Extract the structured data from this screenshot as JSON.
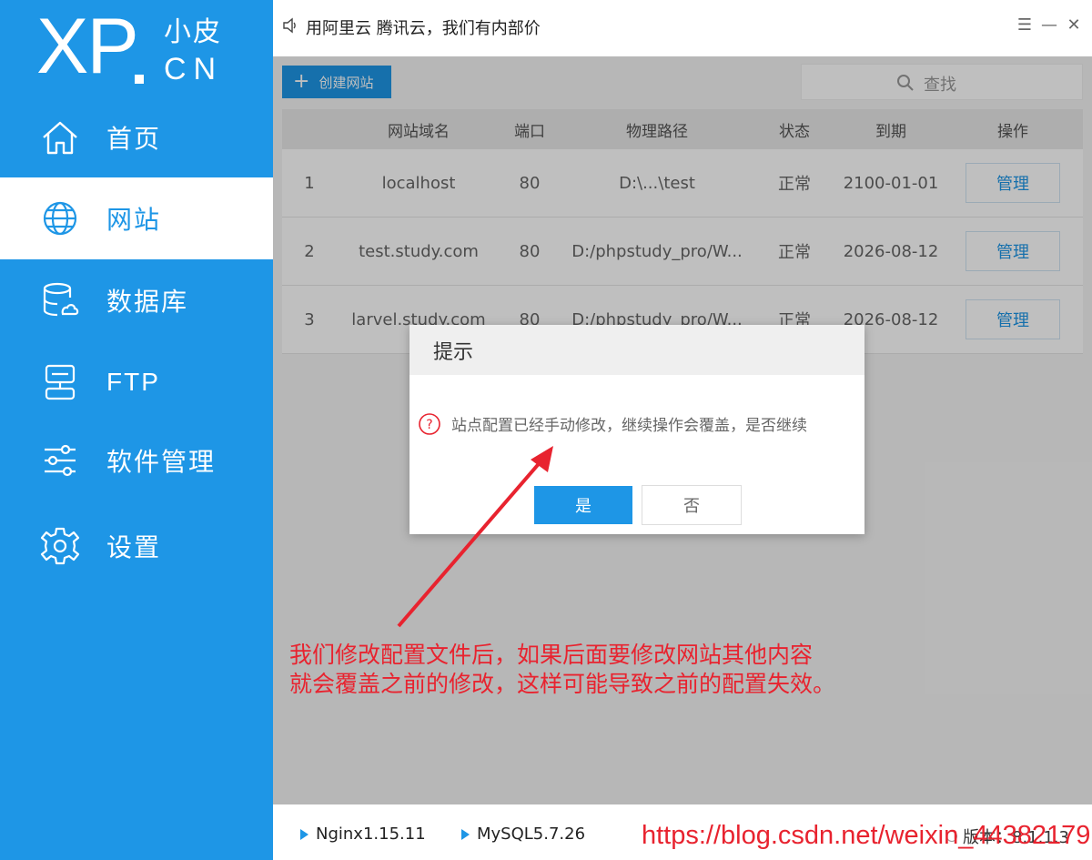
{
  "logo": {
    "xp": "XP",
    "zh": "小皮",
    "cn": "CN"
  },
  "sidebar": {
    "items": [
      {
        "label": "首页",
        "icon": "home-icon",
        "active": false
      },
      {
        "label": "网站",
        "icon": "globe-icon",
        "active": true
      },
      {
        "label": "数据库",
        "icon": "database-icon",
        "active": false
      },
      {
        "label": "FTP",
        "icon": "ftp-icon",
        "active": false
      },
      {
        "label": "软件管理",
        "icon": "sliders-icon",
        "active": false
      },
      {
        "label": "设置",
        "icon": "gear-icon",
        "active": false
      }
    ]
  },
  "titlebar": {
    "notice": "用阿里云 腾讯云，我们有内部价",
    "menu_glyph": "☰",
    "minimize_glyph": "—",
    "close_glyph": "✕"
  },
  "toolbar": {
    "create_label": "创建网站",
    "search_label": "查找"
  },
  "table": {
    "headers": [
      "网站域名",
      "端口",
      "物理路径",
      "状态",
      "到期",
      "操作"
    ],
    "rows": [
      {
        "index": "1",
        "domain": "localhost",
        "port": "80",
        "path": "D:\\...\\test",
        "status": "正常",
        "expiry": "2100-01-01",
        "action": "管理"
      },
      {
        "index": "2",
        "domain": "test.study.com",
        "port": "80",
        "path": "D:/phpstudy_pro/W...",
        "status": "正常",
        "expiry": "2026-08-12",
        "action": "管理"
      },
      {
        "index": "3",
        "domain": "larvel.study.com",
        "port": "80",
        "path": "D:/phpstudy_pro/W...",
        "status": "正常",
        "expiry": "2026-08-12",
        "action": "管理"
      }
    ]
  },
  "dialog": {
    "title": "提示",
    "message": "站点配置已经手动修改，继续操作会覆盖，是否继续",
    "yes_label": "是",
    "no_label": "否"
  },
  "annotation": {
    "line1": "我们修改配置文件后，如果后面要修改网站其他内容",
    "line2": "就会覆盖之前的修改，这样可能导致之前的配置失效。"
  },
  "statusbar": {
    "nginx": "Nginx1.15.11",
    "mysql": "MySQL5.7.26",
    "version": "版本：8.1.1.3"
  },
  "watermark": "https://blog.csdn.net/weixin_44382179",
  "colors": {
    "accent": "#1e96e6",
    "annotation": "#e8232f"
  }
}
